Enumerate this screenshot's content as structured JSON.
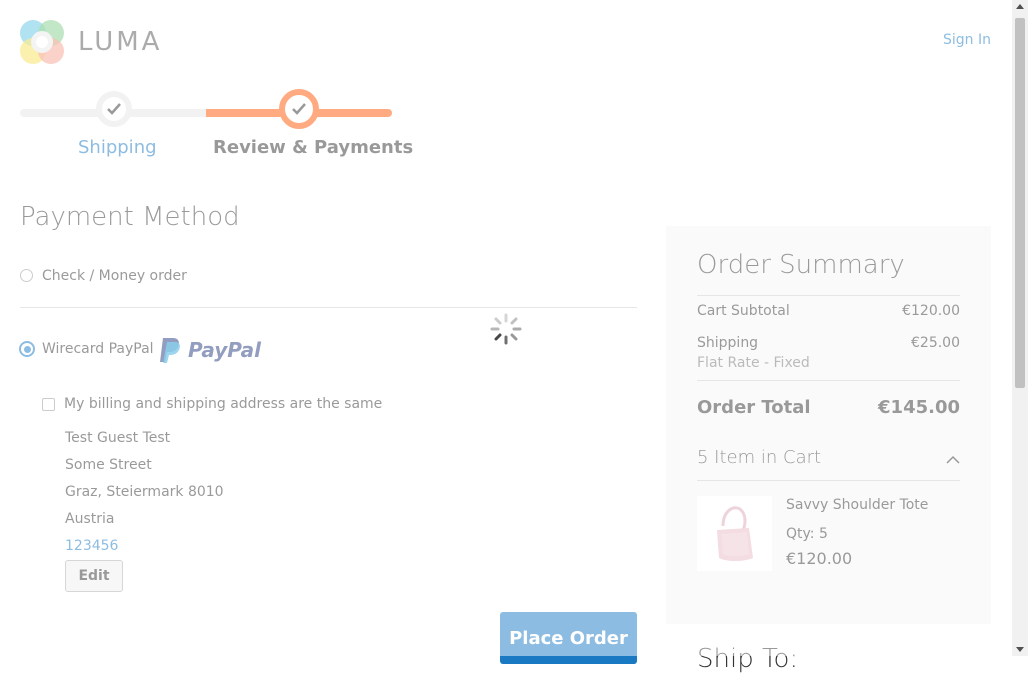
{
  "header": {
    "brand": "LUMA",
    "sign_in": "Sign In"
  },
  "progress": {
    "steps": [
      {
        "label": "Shipping",
        "state": "complete"
      },
      {
        "label": "Review & Payments",
        "state": "active"
      }
    ]
  },
  "payment": {
    "title": "Payment Method",
    "options": [
      {
        "label": "Check / Money order",
        "selected": false
      },
      {
        "label": "Wirecard PayPal",
        "selected": true,
        "logo_text": "PayPal"
      }
    ],
    "billing_same_label": "My billing and shipping address are the same",
    "billing_same_checked": false,
    "address": {
      "name": "Test Guest Test",
      "street": "Some Street",
      "city_line": "Graz, Steiermark 8010",
      "country": "Austria",
      "phone": "123456"
    },
    "edit_label": "Edit",
    "place_order_label": "Place Order"
  },
  "summary": {
    "title": "Order Summary",
    "subtotal_label": "Cart Subtotal",
    "subtotal_value": "€120.00",
    "shipping_label": "Shipping",
    "shipping_method": "Flat Rate - Fixed",
    "shipping_value": "€25.00",
    "total_label": "Order Total",
    "total_value": "€145.00",
    "items_in_cart": "5 Item in Cart",
    "item": {
      "name": "Savvy Shoulder Tote",
      "qty": "Qty: 5",
      "price": "€120.00"
    },
    "ship_to_partial": "Ship To:"
  },
  "colors": {
    "accent_orange": "#ff5501",
    "link_blue": "#1979c3",
    "place_order_blue": "#1979c3"
  }
}
